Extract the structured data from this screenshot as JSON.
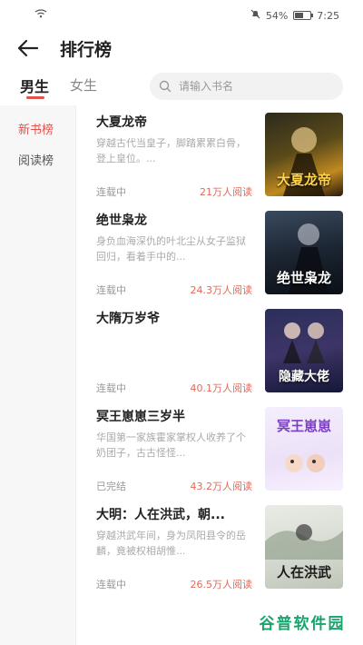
{
  "statusbar": {
    "battery": "54%",
    "time": "7:25",
    "battery_level": 0.54
  },
  "header": {
    "title": "排行榜"
  },
  "tabs": [
    {
      "label": "男生",
      "active": true
    },
    {
      "label": "女生",
      "active": false
    }
  ],
  "search": {
    "placeholder": "请输入书名",
    "value": ""
  },
  "sidebar": {
    "items": [
      {
        "label": "新书榜",
        "active": true
      },
      {
        "label": "阅读榜",
        "active": false
      }
    ]
  },
  "books": [
    {
      "title": "大夏龙帝",
      "desc": "穿越古代当皇子，脚踏累累白骨，登上皇位。...",
      "status": "连载中",
      "reads": "21万人阅读",
      "cover_text": "大夏龙帝"
    },
    {
      "title": "绝世枭龙",
      "desc": "身负血海深仇的叶北尘从女子监狱回归，看着手中的...",
      "status": "连载中",
      "reads": "24.3万人阅读",
      "cover_text": "绝世枭龙"
    },
    {
      "title": "大隋万岁爷",
      "desc": "",
      "status": "连载中",
      "reads": "40.1万人阅读",
      "cover_text": "隐藏大佬"
    },
    {
      "title": "冥王崽崽三岁半",
      "desc": "华国第一家族霍家掌权人收养了个奶团子，古古怪怪...",
      "status": "已完结",
      "reads": "43.2万人阅读",
      "cover_text": "冥王崽崽"
    },
    {
      "title": "大明：人在洪武，朝...",
      "desc": "穿越洪武年间，身为凤阳县令的岳麟，竟被权相胡惟...",
      "status": "连载中",
      "reads": "26.5万人阅读",
      "cover_text": "人在洪武"
    }
  ],
  "watermark": "谷普软件园",
  "colors": {
    "accent": "#e0534a",
    "reads": "#e06a5a"
  }
}
